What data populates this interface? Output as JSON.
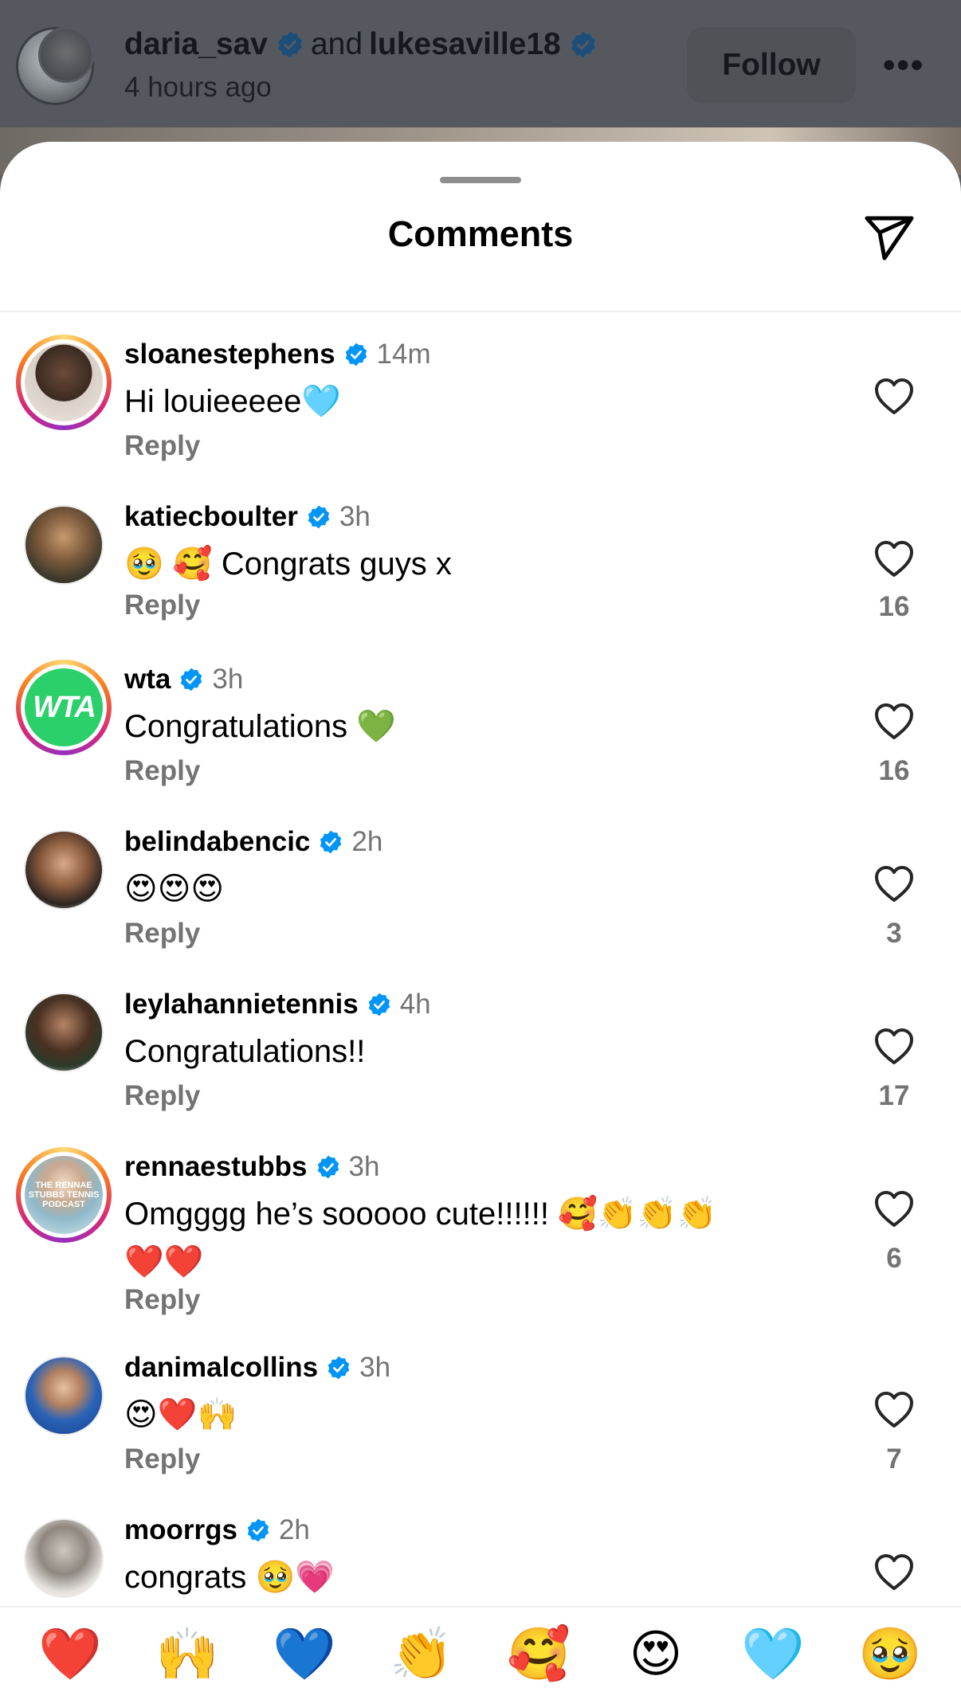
{
  "post": {
    "user1": "daria_sav",
    "and": "and",
    "user2": "lukesaville18",
    "time": "4 hours ago",
    "follow": "Follow",
    "more": "•••"
  },
  "sheet": {
    "title": "Comments"
  },
  "comments": [
    {
      "user": "sloanestephens",
      "time": "14m",
      "text": "Hi louieeeee",
      "emoji": "🩵",
      "reply": "Reply",
      "likes": ""
    },
    {
      "user": "katiecboulter",
      "time": "3h",
      "emoji_pre": "🥹 🥰",
      "text": "Congrats guys x",
      "reply": "Reply",
      "likes": "16"
    },
    {
      "user": "wta",
      "time": "3h",
      "text": "Congratulations",
      "emoji": "💚",
      "reply": "Reply",
      "likes": "16",
      "avatar_text": "WTA"
    },
    {
      "user": "belindabencic",
      "time": "2h",
      "text": "😍😍😍",
      "reply": "Reply",
      "likes": "3"
    },
    {
      "user": "leylahannietennis",
      "time": "4h",
      "text": "Congratulations!!",
      "reply": "Reply",
      "likes": "17"
    },
    {
      "user": "rennaestubbs",
      "time": "3h",
      "text": "Omgggg he’s sooooo cute!!!!!!",
      "emoji": "🥰👏👏👏",
      "line2": "❤️❤️",
      "reply": "Reply",
      "likes": "6",
      "avatar_text": "THE RENNAE STUBBS TENNIS PODCAST"
    },
    {
      "user": "danimalcollins",
      "time": "3h",
      "text": "😍❤️🙌",
      "reply": "Reply",
      "likes": "7"
    },
    {
      "user": "moorrgs",
      "time": "2h",
      "text": "congrats",
      "emoji": "🥹💗",
      "reply": "",
      "likes": ""
    }
  ],
  "emoji_bar": [
    "❤️",
    "🙌",
    "💙",
    "👏",
    "🥰",
    "😍",
    "🩵",
    "🥹"
  ],
  "colors": {
    "verified": "#0095f6",
    "secondary_text": "#737373",
    "wta_green": "#2bd06b"
  }
}
